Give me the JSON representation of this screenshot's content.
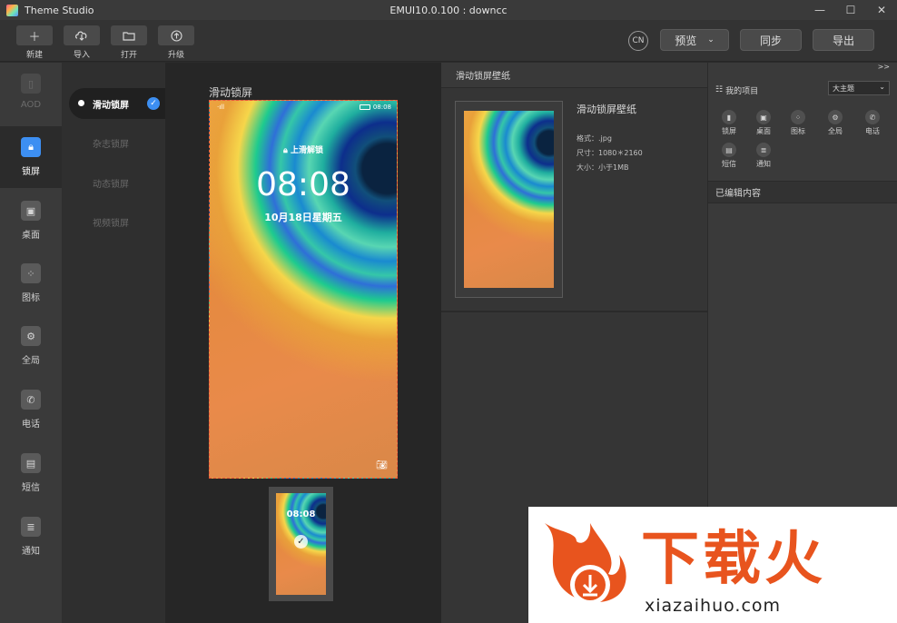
{
  "app": {
    "title": "Theme Studio",
    "window_title": "EMUI10.0.100 : downcc"
  },
  "window_controls": {
    "minimize": "—",
    "maximize": "☐",
    "close": "✕"
  },
  "toolbar": {
    "new": "新建",
    "import": "导入",
    "open": "打开",
    "upgrade": "升级",
    "lang": "CN",
    "preview": "预览",
    "sync": "同步",
    "export": "导出"
  },
  "rail": {
    "items": [
      {
        "label": "AOD",
        "icon": "aod-icon",
        "state": "disabled"
      },
      {
        "label": "锁屏",
        "icon": "lockscreen-icon",
        "state": "active"
      },
      {
        "label": "桌面",
        "icon": "desktop-icon",
        "state": "normal"
      },
      {
        "label": "图标",
        "icon": "icons-icon",
        "state": "normal"
      },
      {
        "label": "全局",
        "icon": "global-icon",
        "state": "normal"
      },
      {
        "label": "电话",
        "icon": "phone-icon",
        "state": "normal"
      },
      {
        "label": "短信",
        "icon": "sms-icon",
        "state": "normal"
      },
      {
        "label": "通知",
        "icon": "notification-icon",
        "state": "normal"
      }
    ]
  },
  "subnav": {
    "items": [
      {
        "label": "滑动锁屏",
        "active": true
      },
      {
        "label": "杂志锁屏",
        "active": false
      },
      {
        "label": "动态锁屏",
        "active": false
      },
      {
        "label": "视频锁屏",
        "active": false
      }
    ]
  },
  "canvas": {
    "title": "滑动锁屏",
    "status_time": "08:08",
    "status_signal": "·ıll",
    "lock_hint": "上滑解锁",
    "clock": "08:08",
    "date": "10月18日星期五",
    "thumb_clock": "08:08"
  },
  "props": {
    "header": "滑动锁屏壁纸",
    "name": "滑动锁屏壁纸",
    "format": "格式：.jpg",
    "size": "尺寸：1080＊2160",
    "filesize": "大小：小于1MB"
  },
  "project": {
    "collapse": ">>",
    "title": "我的项目",
    "select_value": "大主题",
    "items": [
      "锁屏",
      "桌面",
      "图标",
      "全局",
      "电话",
      "短信",
      "通知"
    ],
    "edited_title": "已编辑内容"
  },
  "watermark": {
    "cn": "下载火",
    "en": "xiazaihuo.com"
  },
  "colors": {
    "accent": "#3d8ff2",
    "brand_orange": "#e8541e"
  }
}
